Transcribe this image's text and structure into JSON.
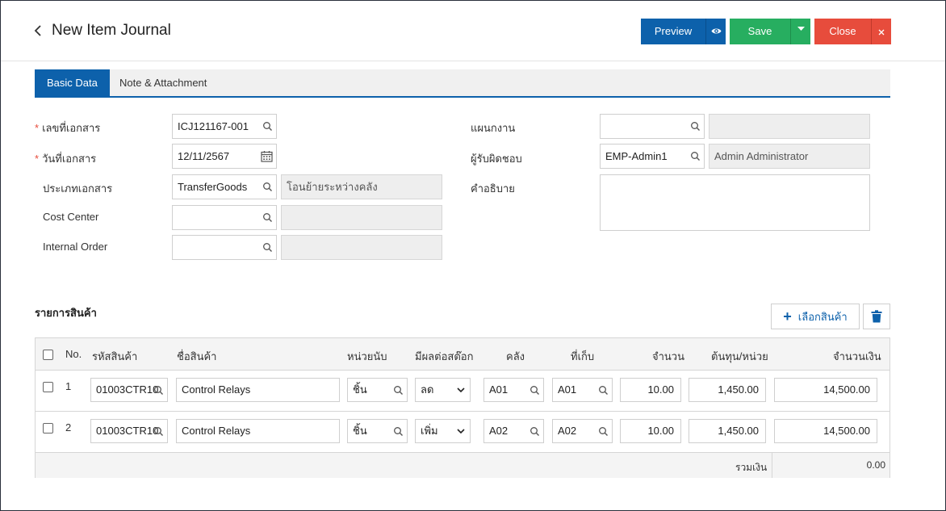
{
  "header": {
    "title": "New Item Journal",
    "preview_label": "Preview",
    "save_label": "Save",
    "close_label": "Close"
  },
  "tabs": [
    {
      "label": "Basic Data",
      "active": true
    },
    {
      "label": "Note & Attachment",
      "active": false
    }
  ],
  "form": {
    "doc_no_label": "เลขที่เอกสาร",
    "doc_no_value": "ICJ121167-001",
    "doc_date_label": "วันที่เอกสาร",
    "doc_date_value": "12/11/2567",
    "doc_type_label": "ประเภทเอกสาร",
    "doc_type_value": "TransferGoods",
    "doc_type_desc": "โอนย้ายระหว่างคลัง",
    "cost_center_label": "Cost Center",
    "cost_center_value": "",
    "cost_center_desc": "",
    "internal_order_label": "Internal Order",
    "internal_order_value": "",
    "internal_order_desc": "",
    "department_label": "แผนกงาน",
    "department_value": "",
    "department_desc": "",
    "responsible_label": "ผู้รับผิดชอบ",
    "responsible_value": "EMP-Admin1",
    "responsible_desc": "Admin Administrator",
    "description_label": "คำอธิบาย",
    "description_value": "",
    "required_mark": "*"
  },
  "items": {
    "section_title": "รายการสินค้า",
    "select_button_label": "เลือกสินค้า",
    "columns": [
      "No.",
      "รหัสสินค้า",
      "ชื่อสินค้า",
      "หน่วยนับ",
      "มีผลต่อสต๊อก",
      "คลัง",
      "ที่เก็บ",
      "จำนวน",
      "ต้นทุน/หน่วย",
      "จำนวนเงิน"
    ],
    "rows": [
      {
        "no": "1",
        "code": "01003CTR10",
        "name": "Control Relays",
        "unit": "ชิ้น",
        "effect": "ลด",
        "warehouse": "A01",
        "location": "A01",
        "qty": "10.00",
        "unit_cost": "1,450.00",
        "amount": "14,500.00"
      },
      {
        "no": "2",
        "code": "01003CTR10",
        "name": "Control Relays",
        "unit": "ชิ้น",
        "effect": "เพิ่ม",
        "warehouse": "A02",
        "location": "A02",
        "qty": "10.00",
        "unit_cost": "1,450.00",
        "amount": "14,500.00"
      }
    ],
    "total_label": "รวมเงิน",
    "total_value": "0.00"
  },
  "colors": {
    "primary": "#0d61ab",
    "success": "#27ae60",
    "danger": "#e74c3c"
  }
}
